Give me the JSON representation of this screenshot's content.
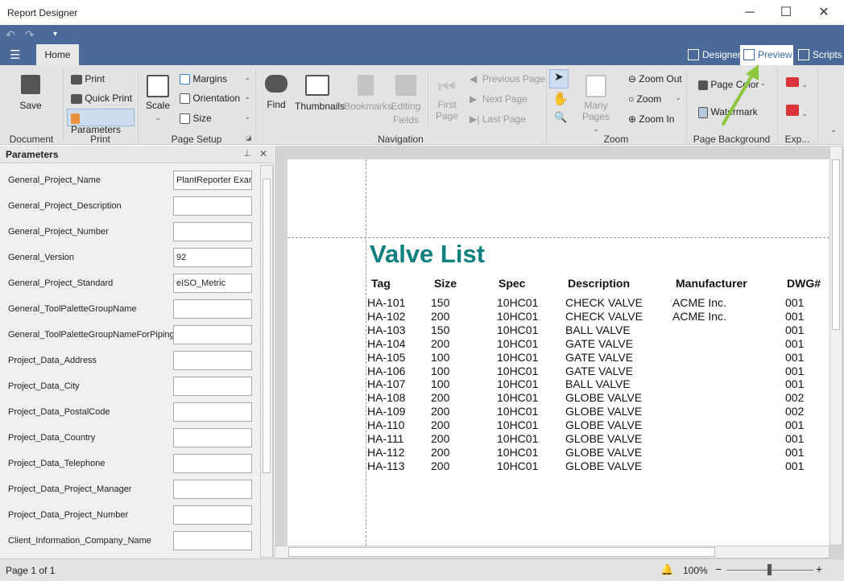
{
  "window": {
    "title": "Report Designer",
    "minimize": "─",
    "maximize": "☐",
    "close": "✕"
  },
  "quick_access": {
    "undo": "↶",
    "redo": "↷",
    "customize": "▾"
  },
  "tabs": {
    "file_menu": "☰",
    "home": "Home"
  },
  "views": [
    {
      "label": "Designer"
    },
    {
      "label": "Preview",
      "selected": true
    },
    {
      "label": "Scripts"
    }
  ],
  "ribbon": {
    "document": {
      "label": "Document",
      "save": "Save"
    },
    "print": {
      "label": "Print",
      "print": "Print",
      "quick_print": "Quick Print",
      "parameters": "Parameters"
    },
    "page_setup": {
      "label": "Page Setup",
      "scale": "Scale",
      "margins": "Margins",
      "orientation": "Orientation",
      "size": "Size"
    },
    "navigation": {
      "label": "Navigation",
      "find": "Find",
      "thumbnails": "Thumbnails",
      "bookmarks": "Bookmarks",
      "editing_fields_1": "Editing",
      "editing_fields_2": "Fields",
      "first_page_1": "First",
      "first_page_2": "Page",
      "previous_page": "Previous Page",
      "next_page": "Next Page",
      "last_page": "Last Page"
    },
    "zoom": {
      "label": "Zoom",
      "many_pages": "Many Pages",
      "zoom_out": "Zoom Out",
      "zoom": "Zoom",
      "zoom_in": "Zoom In"
    },
    "page_background": {
      "label": "Page Background",
      "page_color": "Page Color",
      "watermark": "Watermark"
    },
    "export": {
      "label": "Exp..."
    }
  },
  "parameters_panel": {
    "title": "Parameters",
    "items": [
      {
        "label": "General_Project_Name",
        "value": "PlantReporter Example"
      },
      {
        "label": "General_Project_Description",
        "value": ""
      },
      {
        "label": "General_Project_Number",
        "value": ""
      },
      {
        "label": "General_Version",
        "value": "92"
      },
      {
        "label": "General_Project_Standard",
        "value": "eISO_Metric"
      },
      {
        "label": "General_ToolPaletteGroupName",
        "value": ""
      },
      {
        "label": "General_ToolPaletteGroupNameForPiping",
        "value": ""
      },
      {
        "label": "Project_Data_Address",
        "value": ""
      },
      {
        "label": "Project_Data_City",
        "value": ""
      },
      {
        "label": "Project_Data_PostalCode",
        "value": ""
      },
      {
        "label": "Project_Data_Country",
        "value": ""
      },
      {
        "label": "Project_Data_Telephone",
        "value": ""
      },
      {
        "label": "Project_Data_Project_Manager",
        "value": ""
      },
      {
        "label": "Project_Data_Project_Number",
        "value": ""
      },
      {
        "label": "Client_Information_Company_Name",
        "value": ""
      }
    ]
  },
  "report": {
    "title": "Valve List",
    "title_color": "#0f7f80",
    "columns": [
      "Tag",
      "Size",
      "Spec",
      "Description",
      "Manufacturer",
      "DWG#"
    ],
    "rows": [
      [
        "HA-101",
        "150",
        "10HC01",
        "CHECK VALVE",
        "ACME Inc.",
        "001"
      ],
      [
        "HA-102",
        "200",
        "10HC01",
        "CHECK VALVE",
        "ACME Inc.",
        "001"
      ],
      [
        "HA-103",
        "150",
        "10HC01",
        "BALL VALVE",
        "",
        "001"
      ],
      [
        "HA-104",
        "200",
        "10HC01",
        "GATE VALVE",
        "",
        "001"
      ],
      [
        "HA-105",
        "100",
        "10HC01",
        "GATE VALVE",
        "",
        "001"
      ],
      [
        "HA-106",
        "100",
        "10HC01",
        "GATE VALVE",
        "",
        "001"
      ],
      [
        "HA-107",
        "100",
        "10HC01",
        "BALL VALVE",
        "",
        "001"
      ],
      [
        "HA-108",
        "200",
        "10HC01",
        "GLOBE VALVE",
        "",
        "002"
      ],
      [
        "HA-109",
        "200",
        "10HC01",
        "GLOBE VALVE",
        "",
        "002"
      ],
      [
        "HA-110",
        "200",
        "10HC01",
        "GLOBE VALVE",
        "",
        "001"
      ],
      [
        "HA-111",
        "200",
        "10HC01",
        "GLOBE VALVE",
        "",
        "001"
      ],
      [
        "HA-112",
        "200",
        "10HC01",
        "GLOBE VALVE",
        "",
        "001"
      ],
      [
        "HA-113",
        "200",
        "10HC01",
        "GLOBE VALVE",
        "",
        "001"
      ]
    ]
  },
  "status": {
    "page": "Page 1 of 1",
    "zoom": "100%",
    "zoom_minus": "−",
    "zoom_plus": "+",
    "zoom_level_percent": 100
  },
  "colors": {
    "title_bar_blue": "#4b6a99",
    "annotation_arrow": "#8cc63f"
  }
}
